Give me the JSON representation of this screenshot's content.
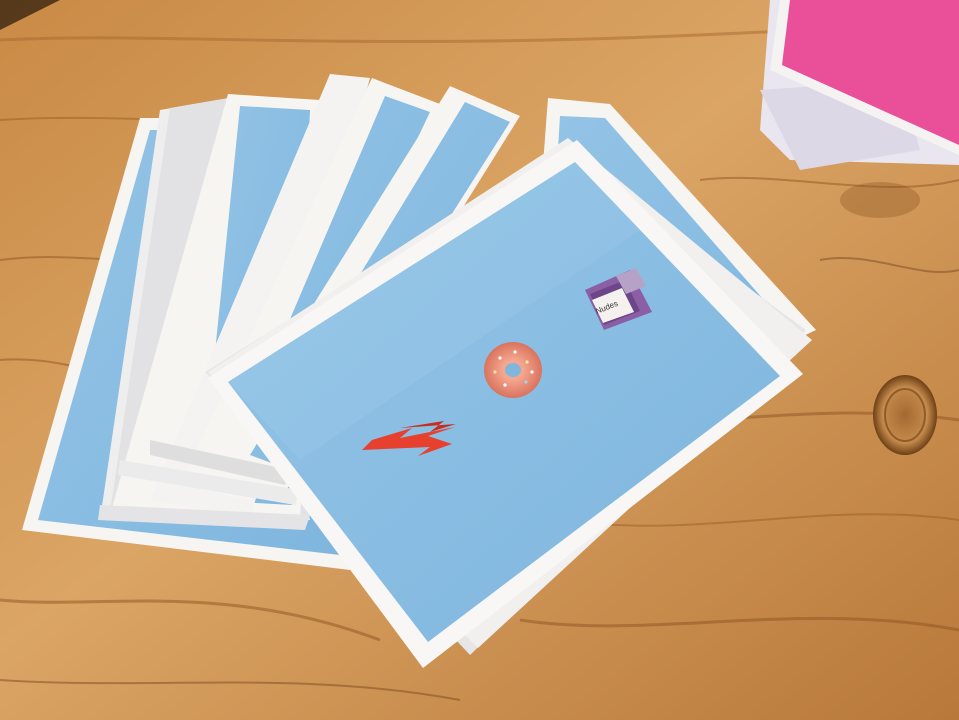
{
  "scene": {
    "subject": "fanned-out-postcards-on-wooden-table",
    "colors": {
      "wood_light": "#d9a05e",
      "wood_mid": "#b87839",
      "wood_dark": "#7a4a20",
      "card_blue": "#8cc0e3",
      "card_blue_light": "#a6d0ee",
      "card_border": "#f7f5f2",
      "card_edge_shadow": "#d6d6d8",
      "pink_card": "#ea4f9a",
      "lightning": "#e8402f",
      "donut": "#e98b77",
      "donut_hole": "#7fb7dc",
      "floppy_body": "#8b5fa5",
      "floppy_label": "#f4f1ee"
    },
    "floppy_label_text": "Nudes",
    "icons": [
      "lightning-bolt-icon",
      "donut-icon",
      "floppy-disk-icon"
    ]
  }
}
